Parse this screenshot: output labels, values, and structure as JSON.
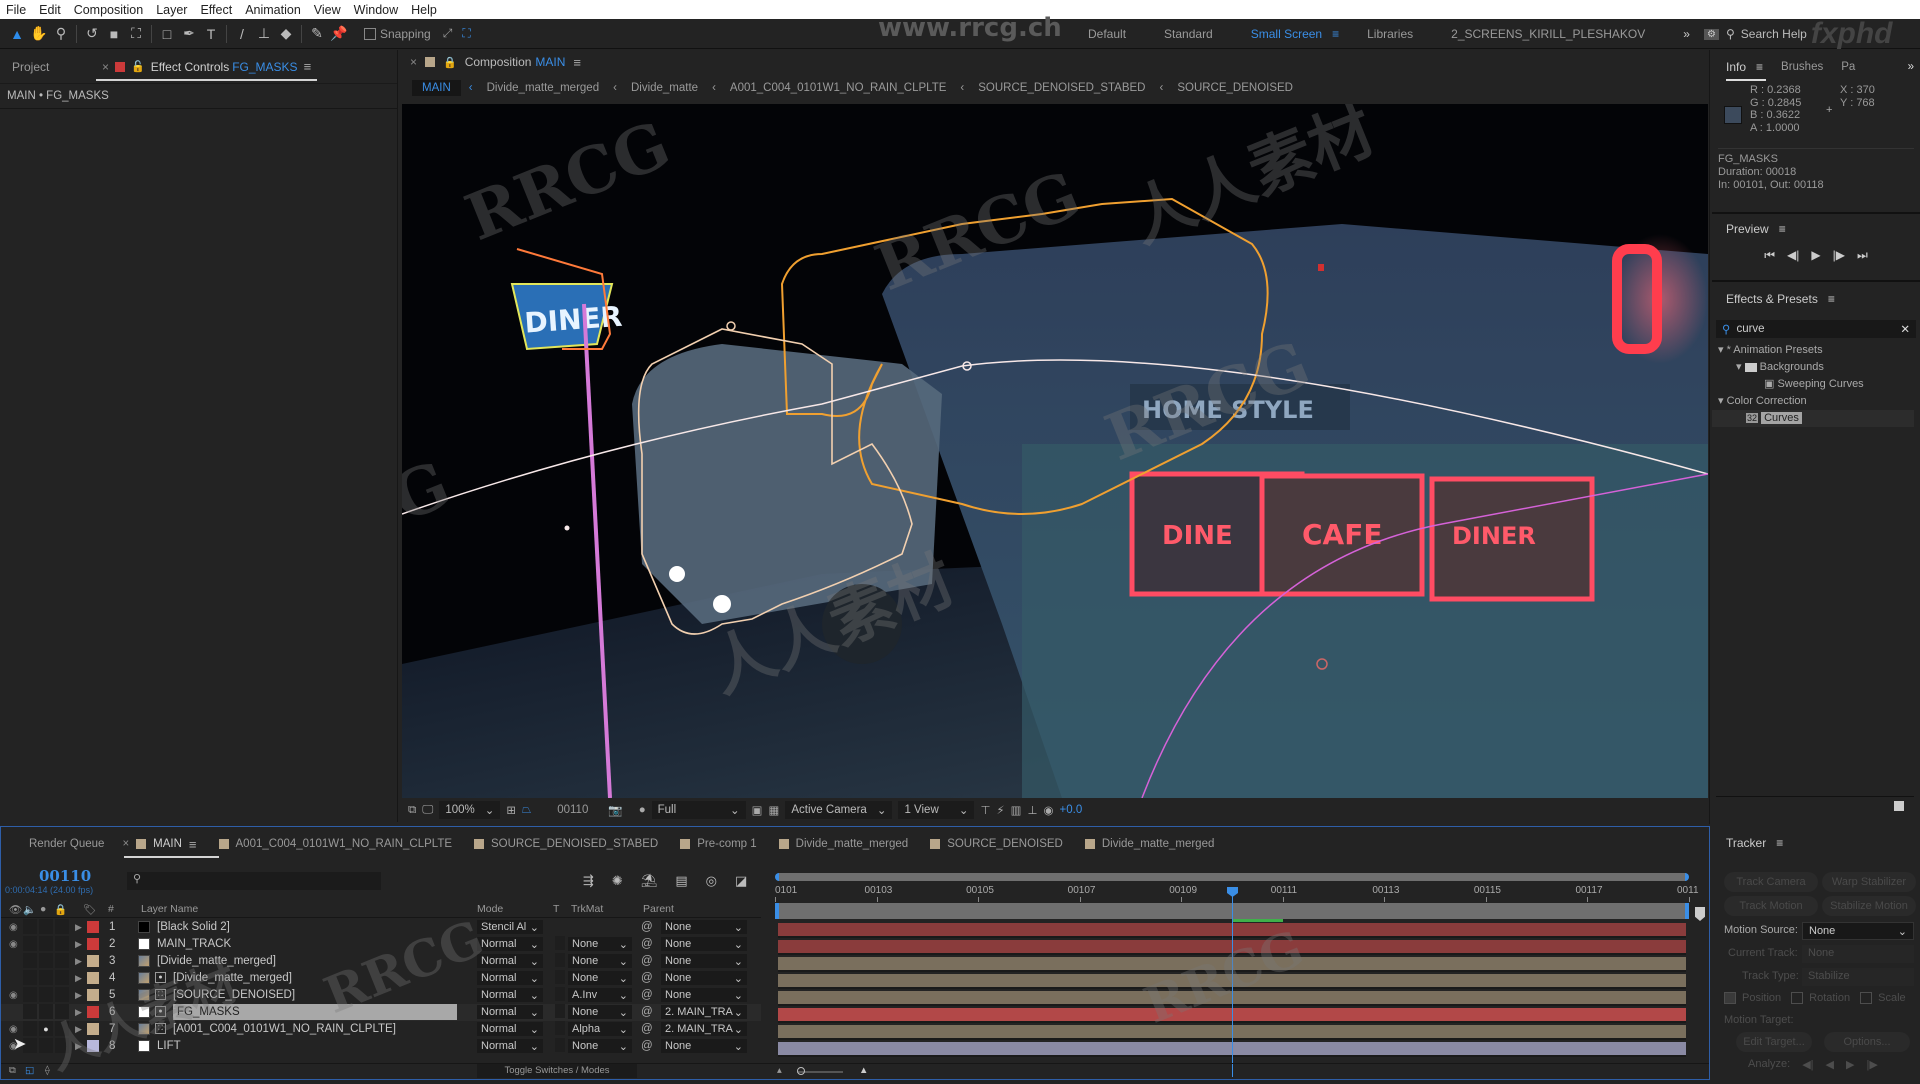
{
  "menu": [
    "File",
    "Edit",
    "Composition",
    "Layer",
    "Effect",
    "Animation",
    "View",
    "Window",
    "Help"
  ],
  "toolbar": {
    "tools": [
      "selection-tool",
      "hand-tool",
      "zoom-tool",
      "rotate-tool",
      "camera-tool",
      "pan-behind-tool",
      "rectangle-tool",
      "pen-tool",
      "type-tool",
      "brush-tool",
      "clone-stamp-tool",
      "eraser-tool",
      "roto-brush-tool",
      "puppet-pin-tool"
    ],
    "snapping_label": "Snapping",
    "snapping_checked": false,
    "workspaces": [
      "Default",
      "Standard",
      "Small Screen",
      "Libraries",
      "2_SCREENS_KIRILL_PLESHAKOV"
    ],
    "active_workspace": "Small Screen",
    "search_help_placeholder": "Search Help"
  },
  "watermarks": {
    "site": "www.rrcg.ch",
    "brand": "fxphd",
    "logo": "RRCG",
    "cn": "人人素材"
  },
  "left_panel": {
    "tabs": [
      {
        "label": "Project"
      },
      {
        "label": "Effect Controls",
        "highlight": "FG_MASKS"
      }
    ],
    "subtitle": "MAIN • FG_MASKS"
  },
  "composition": {
    "tab_label": "Composition",
    "tab_name": "MAIN",
    "breadcrumbs": [
      "MAIN",
      "Divide_matte_merged",
      "Divide_matte",
      "A001_C004_0101W1_NO_RAIN_CLPLTE",
      "SOURCE_DENOISED_STABED",
      "SOURCE_DENOISED"
    ],
    "viewer_sign_text": "DINER",
    "viewer_text": [
      "HOME STYLE",
      "DINE",
      "CAFE",
      "DINER"
    ],
    "controls": {
      "zoom": "100%",
      "timecode": "00110",
      "resolution": "Full",
      "camera": "Active Camera",
      "views": "1 View",
      "exposure": "+0.0"
    }
  },
  "info_panel": {
    "tabs": [
      "Info",
      "Brushes",
      "Pa"
    ],
    "R": "0.2368",
    "G": "0.2845",
    "B": "0.3622",
    "A": "1.0000",
    "X": "370",
    "Y": "768",
    "swatch_color": "#3c4a5c",
    "layer_name": "FG_MASKS",
    "duration": "Duration: 00018",
    "in_out": "In: 00101, Out: 00118"
  },
  "preview_panel": {
    "title": "Preview",
    "controls": [
      "first-frame",
      "prev-frame",
      "play",
      "next-frame",
      "last-frame"
    ]
  },
  "effects_panel": {
    "title": "Effects & Presets",
    "search_value": "curve",
    "tree": [
      {
        "label": "* Animation Presets",
        "level": 0
      },
      {
        "label": "Backgrounds",
        "level": 1
      },
      {
        "label": "Sweeping Curves",
        "level": 2
      },
      {
        "label": "Color Correction",
        "level": 0
      },
      {
        "label": "Curves",
        "level": 1,
        "selected": true
      }
    ]
  },
  "timeline": {
    "tabs": [
      {
        "label": "Render Queue"
      },
      {
        "label": "MAIN",
        "active": true,
        "color": "#b8a68a"
      },
      {
        "label": "A001_C004_0101W1_NO_RAIN_CLPLTE",
        "color": "#b8a68a"
      },
      {
        "label": "SOURCE_DENOISED_STABED",
        "color": "#b8a68a"
      },
      {
        "label": "Pre-comp 1",
        "color": "#b8a68a"
      },
      {
        "label": "Divide_matte_merged",
        "color": "#b8a68a"
      },
      {
        "label": "SOURCE_DENOISED",
        "color": "#b8a68a"
      },
      {
        "label": "Divide_matte_merged",
        "color": "#b8a68a"
      }
    ],
    "current_frame": "00110",
    "timecode_sub": "0:00:04:14 (24.00 fps)",
    "columns": {
      "layer_name": "Layer Name",
      "mode": "Mode",
      "t": "T",
      "trkmat": "TrkMat",
      "parent": "Parent",
      "num": "#"
    },
    "ruler": [
      "0101",
      "00103",
      "00105",
      "00107",
      "00109",
      "00111",
      "00113",
      "00115",
      "00117",
      "0011"
    ],
    "playhead_frame": 110,
    "range_start": 101,
    "range_end": 119,
    "layers": [
      {
        "num": "1",
        "name": "[Black Solid 2]",
        "label": "#cc3a3a",
        "thumb": "black",
        "mode": "Stencil Al",
        "trkmat": "",
        "parent": "None",
        "visible": true,
        "bar": "#8a3c3c"
      },
      {
        "num": "2",
        "name": "MAIN_TRACK",
        "label": "#cc3a3a",
        "thumb": "white",
        "mode": "Normal",
        "trkmat": "None",
        "parent": "None",
        "visible": true,
        "bar": "#8a3c3c"
      },
      {
        "num": "3",
        "name": "[Divide_matte_merged]",
        "label": "#c4ad8c",
        "thumb": "comp",
        "mode": "Normal",
        "trkmat": "None",
        "parent": "None",
        "visible": false,
        "bar": "#7a6f5d"
      },
      {
        "num": "4",
        "name": "[Divide_matte_merged]",
        "label": "#c4ad8c",
        "thumb": "comp",
        "mode": "Normal",
        "trkmat": "None",
        "parent": "None",
        "visible": false,
        "bar": "#7a6f5d"
      },
      {
        "num": "5",
        "name": "[SOURCE_DENOISED]",
        "label": "#c4ad8c",
        "thumb": "comp",
        "mode": "Normal",
        "trkmat": "A.Inv",
        "parent": "None",
        "visible": true,
        "bar": "#7a6f5d"
      },
      {
        "num": "6",
        "name": "FG_MASKS",
        "label": "#cc3a3a",
        "thumb": "white",
        "mode": "Normal",
        "trkmat": "None",
        "parent": "2. MAIN_TRA",
        "visible": false,
        "selected": true,
        "bar": "#b24848"
      },
      {
        "num": "7",
        "name": "[A001_C004_0101W1_NO_RAIN_CLPLTE]",
        "label": "#c4ad8c",
        "thumb": "comp",
        "mode": "Normal",
        "trkmat": "Alpha",
        "parent": "2. MAIN_TRA",
        "visible": true,
        "solo": true,
        "bar": "#7a6f5d"
      },
      {
        "num": "8",
        "name": "LIFT",
        "label": "#b8b8dc",
        "thumb": "white",
        "mode": "Normal",
        "trkmat": "None",
        "parent": "None",
        "visible": true,
        "bar": "#8a8aa4"
      }
    ],
    "toggle_label": "Toggle Switches / Modes"
  },
  "tracker": {
    "title": "Tracker",
    "buttons": [
      "Track Camera",
      "Warp Stabilizer",
      "Track Motion",
      "Stabilize Motion"
    ],
    "motion_source_label": "Motion Source:",
    "motion_source": "None",
    "current_track_label": "Current Track:",
    "current_track": "None",
    "track_type_label": "Track Type:",
    "track_type": "Stabilize",
    "checks": [
      {
        "label": "Position",
        "checked": true
      },
      {
        "label": "Rotation",
        "checked": false
      },
      {
        "label": "Scale",
        "checked": false
      }
    ],
    "motion_target_label": "Motion Target:",
    "edit_target": "Edit Target...",
    "options": "Options...",
    "analyze_label": "Analyze:"
  }
}
